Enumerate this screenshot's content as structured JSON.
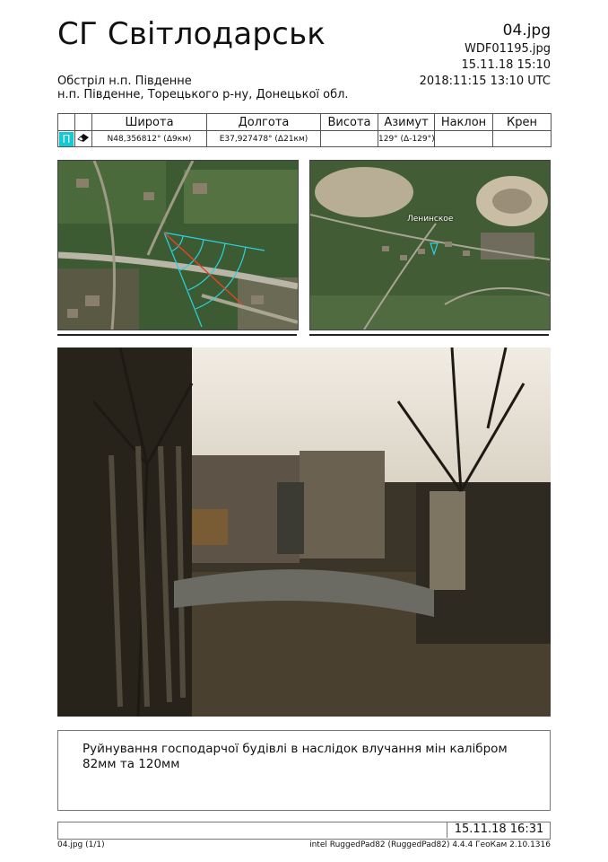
{
  "header": {
    "title": "СГ Світлодарськ",
    "filename": "04.jpg",
    "photo_id": "WDF01195.jpg",
    "local_time": "15.11.18 15:10",
    "utc_time": "2018:11:15 13:10 UTC",
    "subtitle_line1": "Обстріл н.п. Південне",
    "subtitle_line2": "н.п. Південне, Торецького р-ну, Донецької обл."
  },
  "coords_table": {
    "headers": [
      "Широта",
      "Долгота",
      "Висота",
      "Азимут",
      "Наклон",
      "Крен"
    ],
    "marker_label": "П",
    "latitude": "N48,356812° (Δ9км)",
    "longitude": "E37,927478° (Δ21км)",
    "altitude": "",
    "azimuth": "129° (Δ-129°)",
    "tilt": "",
    "roll": ""
  },
  "map_right": {
    "place_label": "Ленинское"
  },
  "caption": "Руйнування господарчої будівлі в наслідок влучання мін калібром 82мм та 120мм",
  "footer": {
    "date": "15.11.18 16:31",
    "page": "04.jpg (1/1)",
    "device": "intel RuggedPad82 (RuggedPad82) 4.4.4 ГеоКам 2.10.1316"
  },
  "colors": {
    "accent": "#14c9d6",
    "direction_line": "#e0452a"
  },
  "icons": {
    "marker": "eraser-icon"
  }
}
